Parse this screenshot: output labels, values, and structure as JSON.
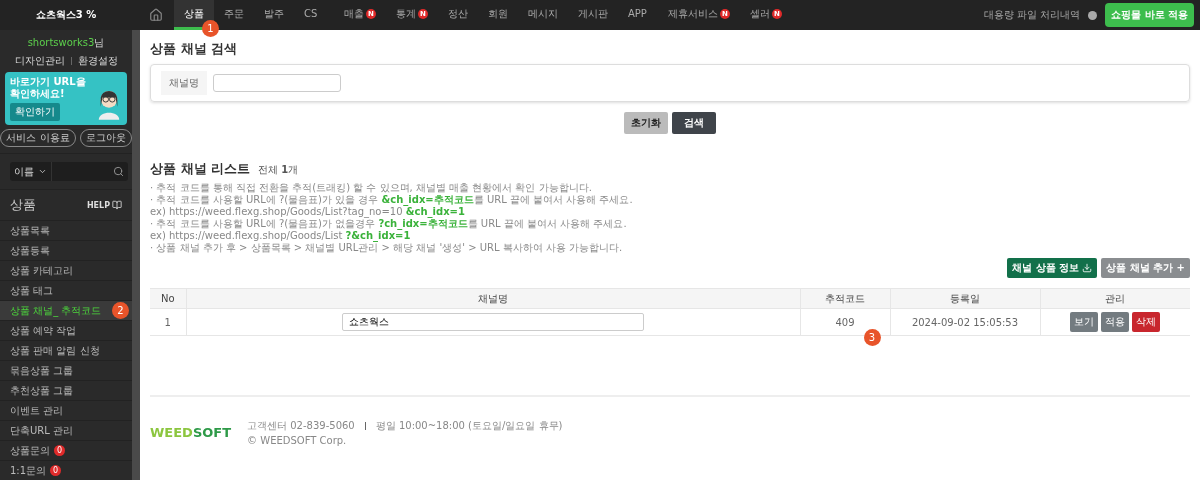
{
  "brand": "쇼츠웍스3 %",
  "nav": [
    {
      "label": "상품",
      "selected": true,
      "marker": "1"
    },
    {
      "label": "주문",
      "selected": false
    },
    {
      "label": "발주",
      "selected": false
    },
    {
      "label": "CS",
      "selected": false
    },
    {
      "label": "매출",
      "selected": false,
      "badge": "N"
    },
    {
      "label": "통계",
      "selected": false,
      "badge": "N"
    },
    {
      "label": "정산",
      "selected": false
    },
    {
      "label": "회원",
      "selected": false
    },
    {
      "label": "메시지",
      "selected": false
    },
    {
      "label": "게시판",
      "selected": false
    },
    {
      "label": "APP",
      "selected": false
    },
    {
      "label": "제휴서비스",
      "selected": false,
      "badge": "N"
    },
    {
      "label": "셀러",
      "selected": false,
      "badge": "N"
    }
  ],
  "bulk_link": "대용량 파일 처리내역",
  "apply_button": "쇼핑몰 바로 적용",
  "user": {
    "name": "shortsworks3",
    "suffix": "님",
    "links": [
      "디자인관리",
      "환경설정"
    ]
  },
  "banner": {
    "text": "바로가기 URL을 확인하세요!",
    "button": "확인하기"
  },
  "user_buttons": [
    "서비스 이용료",
    "로그아웃"
  ],
  "sidebar_search": {
    "option": "이름"
  },
  "sidebar": {
    "title": "상품",
    "help": "HELP",
    "items": [
      {
        "label": "상품목록",
        "selected": false
      },
      {
        "label": "상품등록",
        "selected": false
      },
      {
        "label": "상품 카테고리",
        "selected": false
      },
      {
        "label": "상품 태그",
        "selected": false
      },
      {
        "label": "상품 채널_ 추적코드",
        "selected": true,
        "marker": "2"
      },
      {
        "label": "상품 예약 작업",
        "selected": false
      },
      {
        "label": "상품 판매 알림 신청",
        "selected": false
      },
      {
        "label": "묶음상품 그룹",
        "selected": false
      },
      {
        "label": "추천상품 그룹",
        "selected": false
      },
      {
        "label": "이벤트 관리",
        "selected": false
      },
      {
        "label": "단축URL 관리",
        "selected": false
      },
      {
        "label": "상품문의",
        "selected": false,
        "count": "0"
      },
      {
        "label": "1:1문의",
        "selected": false,
        "count": "0"
      }
    ]
  },
  "search_section": {
    "title": "상품 채널 검색",
    "field_label": "채널명",
    "buttons": [
      {
        "label": "초기화",
        "kind": "light"
      },
      {
        "label": "검색",
        "kind": "dark"
      }
    ]
  },
  "list_section": {
    "title": "상품 채널 리스트",
    "count": "전체 **1**개",
    "notes": [
      "· 추적 코드를 통해 직접 전환을 추적(트래킹) 할 수 있으며, 채널별 매출 현황에서 확인 가능합니다.",
      "· 추적 코드를 사용할 URL에 ?(물음표)가 있을 경우 **&ch_idx=추적코드**를 URL 끝에 붙여서 사용해 주세요.",
      "ex) https://weed.flexg.shop/Goods/List?tag_no=10 **&ch_idx=1**",
      "· 추적 코드를 사용할 URL에 ?(물음표)가 없을경우 **?ch_idx=추적코드**를 URL 끝에 붙여서 사용해 주세요.",
      "ex) https://weed.flexg.shop/Goods/List **?&ch_idx=1**",
      "· 상품 채널 추가 후 > 상품목록 > 채널별 URL관리 > 해당 채널 '생성' > URL 복사하여 사용 가능합니다."
    ],
    "actions": [
      {
        "label": "채널 상품 정보",
        "kind": "download"
      },
      {
        "label": "상품 채널 추가 +",
        "kind": "add"
      }
    ]
  },
  "table": {
    "columns": [
      "No",
      "채널명",
      "추적코드",
      "등록일",
      "관리"
    ],
    "rows": [
      {
        "no": "1",
        "channel": "쇼츠웍스",
        "code": "409",
        "marker": "3",
        "date": "2024-09-02 15:05:53",
        "actions": [
          {
            "label": "보기",
            "kind": "gray"
          },
          {
            "label": "적용",
            "kind": "gray"
          },
          {
            "label": "삭제",
            "kind": "red"
          }
        ]
      }
    ]
  },
  "footer": {
    "logo": [
      "WEED",
      "SOFT"
    ],
    "contact": "고객센터 02-839-5060",
    "hours": "평일 10:00~18:00 (토요일/일요일 휴무)",
    "copyright": "© WEEDSOFT Corp."
  }
}
